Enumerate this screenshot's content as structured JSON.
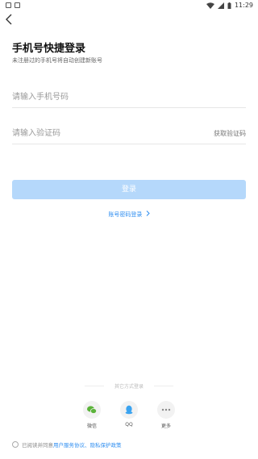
{
  "status": {
    "time": "11:29"
  },
  "header": {
    "title": "手机号快捷登录",
    "subtitle": "未注册过的手机号将自动创建新账号"
  },
  "form": {
    "phone_placeholder": "请输入手机号码",
    "code_placeholder": "请输入验证码",
    "get_code_label": "获取验证码",
    "login_label": "登录",
    "password_login_label": "账号密码登录"
  },
  "other_login": {
    "title": "其它方式登录",
    "items": [
      {
        "label": "微信",
        "icon": "wechat-icon",
        "color": "#5bb33a"
      },
      {
        "label": "QQ",
        "icon": "qq-icon",
        "color": "#3aa3f0"
      },
      {
        "label": "更多",
        "icon": "more-icon",
        "color": "#888888"
      }
    ]
  },
  "agreement": {
    "prefix": "已阅读并同意",
    "user_agreement": "用户服务协议",
    "separator": "、",
    "privacy_policy": "隐私保护政策"
  },
  "colors": {
    "accent": "#2f8ef0",
    "login_button_disabled": "#b5d8fb"
  }
}
